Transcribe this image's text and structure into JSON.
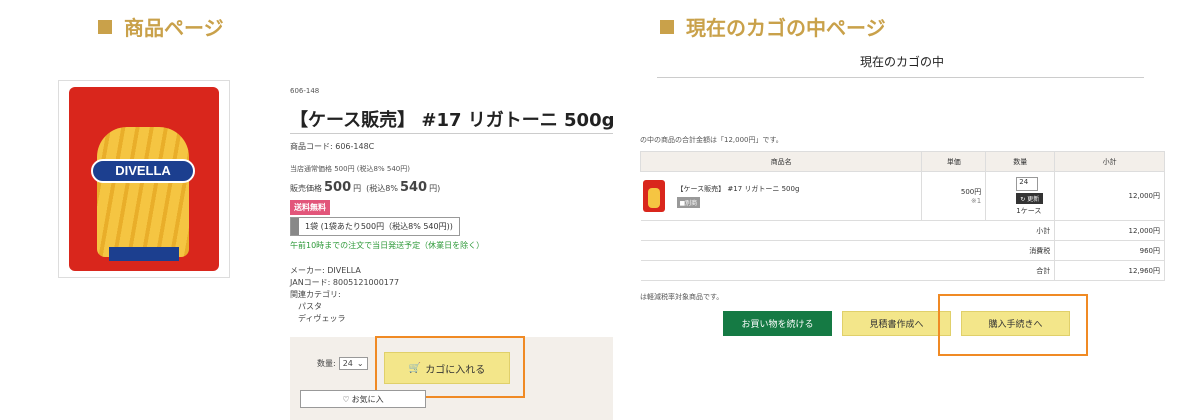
{
  "left_heading": "商品ページ",
  "right_heading": "現在のカゴの中ページ",
  "product": {
    "image_brand": "DIVELLA",
    "code_top": "606-148",
    "title": "【ケース販売】 #17 リガトーニ 500g",
    "product_code": "商品コード: 606-148C",
    "regular_price": "当店通常価格 500円 (税込8% 540円)",
    "sale_label": "販売価格",
    "sale_price": "500",
    "sale_unit": "円",
    "tax_label": "(税込8%",
    "tax_price": "540",
    "tax_unit": "円)",
    "free_shipping": "送料無料",
    "unit_option": "1袋 (1袋あたり500円（税込8% 540円))",
    "shipping_note": "午前10時までの注文で当日発送予定（休業日を除く）",
    "maker": "メーカー: DIVELLA",
    "jan": "JANコード: 8005121000177",
    "category_label": "関連カテゴリ:",
    "categories": [
      "パスタ",
      "ディヴェッラ"
    ],
    "qty_label": "数量:",
    "qty_value": "24",
    "add_to_cart": "カゴに入れる",
    "favorite": "お気に入"
  },
  "cart": {
    "title": "現在のカゴの中",
    "total_note": "の中の商品の合計金額は「12,000円」です。",
    "headers": [
      "商品名",
      "単価",
      "数量",
      "小計"
    ],
    "item": {
      "name": "【ケース販売】 #17 リガトーニ 500g",
      "tag": "■別商",
      "unit_price": "500円",
      "unit_note": "※1",
      "qty": "24",
      "update": "更新",
      "case": "1ケース",
      "subtotal": "12,000円"
    },
    "summary": [
      {
        "label": "小計",
        "value": "12,000円"
      },
      {
        "label": "消費税",
        "value": "960円"
      },
      {
        "label": "合計",
        "value": "12,960円"
      }
    ],
    "reduced_note": "は軽減税率対象商品です。",
    "continue_btn": "お買い物を続ける",
    "quote_btn": "見積書作成へ",
    "checkout_btn": "購入手続きへ"
  },
  "colors": {
    "heading": "#c9a14a",
    "highlight": "#f08a24",
    "green_button": "#157a44",
    "yellow_button": "#f3e68a"
  }
}
